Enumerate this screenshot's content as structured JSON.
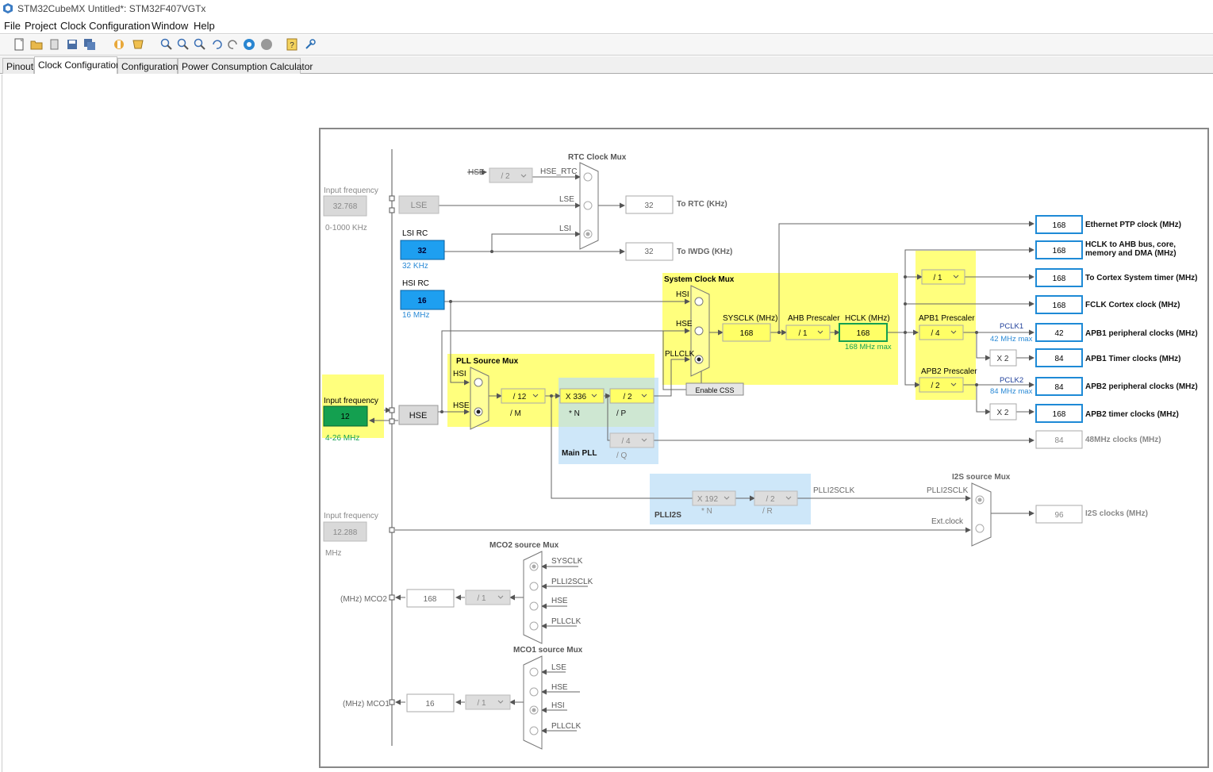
{
  "window": {
    "title": "STM32CubeMX Untitled*: STM32F407VGTx"
  },
  "menu": [
    "File",
    "Project",
    "Clock Configuration",
    "Window",
    "Help"
  ],
  "toolbar_icons": [
    "new-project-icon",
    "open-folder-icon",
    "copy-icon",
    "save-icon",
    "save-all-icon",
    "generate-report-icon",
    "generate-code-icon",
    "zoom-in-icon",
    "zoom-out-icon",
    "zoom-fit-icon",
    "undo-icon",
    "redo-icon",
    "refresh-icon",
    "stop-icon",
    "help-icon",
    "about-icon"
  ],
  "tabs": [
    {
      "label": "Pinout"
    },
    {
      "label": "Clock Configuration",
      "active": true
    },
    {
      "label": "Configuration"
    },
    {
      "label": "Power Consumption Calculator"
    }
  ],
  "clock": {
    "lse": {
      "title": "Input frequency",
      "value": "32.768",
      "range": "0-1000 KHz",
      "label": "LSE"
    },
    "lsi": {
      "title": "LSI RC",
      "value": "32",
      "unit": "32 KHz"
    },
    "hsi": {
      "title": "HSI RC",
      "value": "16",
      "unit": "16 MHz"
    },
    "hse": {
      "title": "Input frequency",
      "value": "12",
      "range": "4-26 MHz",
      "label": "HSE"
    },
    "i2s_in": {
      "title": "Input frequency",
      "value": "12.288",
      "unit": "MHz"
    },
    "rtc": {
      "title": "RTC Clock Mux",
      "hse_label": "HSE",
      "hse_div": "/ 2",
      "hse_rtc": "HSE_RTC",
      "lse": "LSE",
      "lsi": "LSI",
      "to_rtc": "32",
      "to_rtc_label": "To RTC (KHz)",
      "to_iwdg": "32",
      "to_iwdg_label": "To IWDG (KHz)"
    },
    "pll_source": {
      "title": "PLL Source Mux",
      "hsi": "HSI",
      "hse": "HSE"
    },
    "pll": {
      "title": "Main PLL",
      "m": "/ 12",
      "m_label": "/ M",
      "n": "X 336",
      "n_label": "* N",
      "p": "/ 2",
      "p_label": "/ P",
      "q": "/ 4",
      "q_label": "/ Q"
    },
    "sysmux": {
      "title": "System Clock Mux",
      "hsi": "HSI",
      "hse": "HSE",
      "pllclk": "PLLCLK",
      "css": "Enable CSS"
    },
    "sysclk": {
      "label": "SYSCLK (MHz)",
      "value": "168"
    },
    "ahb": {
      "label": "AHB Prescaler",
      "value": "/ 1"
    },
    "hclk": {
      "label": "HCLK (MHz)",
      "value": "168",
      "max": "168 MHz max"
    },
    "cortex_div": "/ 1",
    "apb1": {
      "label": "APB1 Prescaler",
      "value": "/ 4",
      "pclk": "PCLK1",
      "max": "42 MHz max",
      "x2": "X 2"
    },
    "apb2": {
      "label": "APB2 Prescaler",
      "value": "/ 2",
      "pclk": "PCLK2",
      "max": "84 MHz max",
      "x2": "X 2"
    },
    "outputs": [
      {
        "value": "168",
        "label": "Ethernet PTP clock (MHz)"
      },
      {
        "value": "168",
        "label": "HCLK to AHB bus, core,",
        "label2": "memory and DMA (MHz)"
      },
      {
        "value": "168",
        "label": "To Cortex System timer (MHz)"
      },
      {
        "value": "168",
        "label": "FCLK Cortex clock (MHz)"
      },
      {
        "value": "42",
        "label": "APB1 peripheral clocks (MHz)"
      },
      {
        "value": "84",
        "label": "APB1 Timer clocks (MHz)"
      },
      {
        "value": "84",
        "label": "APB2 peripheral clocks (MHz)"
      },
      {
        "value": "168",
        "label": "APB2 timer clocks (MHz)"
      },
      {
        "value": "84",
        "label": "48MHz clocks (MHz)"
      }
    ],
    "plli2s": {
      "title": "PLLI2S",
      "n": "X 192",
      "n_label": "* N",
      "r": "/ 2",
      "r_label": "/ R",
      "out": "PLLI2SCLK"
    },
    "i2s_mux": {
      "title": "I2S source Mux",
      "plli2sclk": "PLLI2SCLK",
      "ext": "Ext.clock",
      "value": "96",
      "label": "I2S clocks (MHz)"
    },
    "mco2": {
      "title": "MCO2 source Mux",
      "inputs": [
        "SYSCLK",
        "PLLI2SCLK",
        "HSE",
        "PLLCLK"
      ],
      "div": "/ 1",
      "value": "168",
      "label": "(MHz) MCO2"
    },
    "mco1": {
      "title": "MCO1 source Mux",
      "inputs": [
        "LSE",
        "HSE",
        "HSI",
        "PLLCLK"
      ],
      "div": "/ 1",
      "value": "16",
      "label": "(MHz) MCO1"
    }
  }
}
